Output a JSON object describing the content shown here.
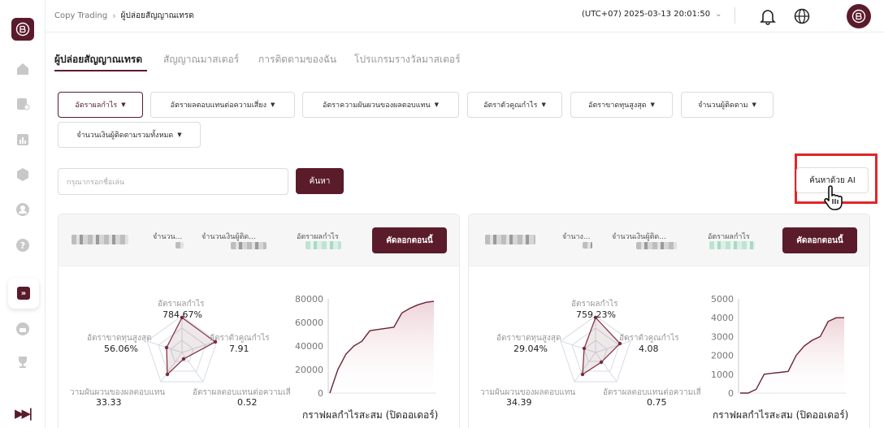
{
  "breadcrumb": {
    "root": "Copy Trading",
    "current": "ผู้ปล่อยสัญญาณเทรด"
  },
  "header": {
    "timezone": "(UTC+07)  2025-03-13 20:01:50"
  },
  "tabs": [
    {
      "label": "ผู้ปล่อยสัญญาณเทรด"
    },
    {
      "label": "สัญญาณมาสเตอร์"
    },
    {
      "label": "การติดตามของฉัน"
    },
    {
      "label": "โปรแกรมรางวัลมาสเตอร์"
    }
  ],
  "filters": [
    {
      "label": "อัตราผลกำไร"
    },
    {
      "label": "อัตราผลตอบแทนต่อความเสี่ยง"
    },
    {
      "label": "อัตราความผันผวนของผลตอบแทน"
    },
    {
      "label": "อัตราตัวคูณกำไร"
    },
    {
      "label": "อัตราขาดทุนสูงสุด"
    },
    {
      "label": "จำนวนผู้ติดตาม"
    },
    {
      "label": "จำนวนเงินผู้ติดตามรวมทั้งหมด"
    }
  ],
  "search": {
    "placeholder": "กรุณากรอกชื่อเล่น",
    "button": "ค้นหา",
    "ai_button": "ค้นหาด้วย AI"
  },
  "cards": [
    {
      "meta": {
        "followers": "จำนวน...",
        "amount": "จำนวนเงินผู้ติด...",
        "profit": "อัตราผลกำไร"
      },
      "copy_button": "คัดลอกตอนนี้",
      "radar": {
        "axes": [
          "อัตราผลกำไร",
          "อัตราตัวคูณกำไร",
          "อัตราผลตอบแทนต่อความเสี่ยง",
          "วามผันผวนของผลตอบแทน",
          "อัตราขาดทุนสูงสุด"
        ],
        "values": [
          "784.67%",
          "7.91",
          "0.52",
          "33.33",
          "56.06%"
        ]
      },
      "chart_caption": "กราฟผลกำไรสะสม (ปิดออเดอร์)",
      "chart_data": {
        "type": "area",
        "ylim": [
          0,
          80000
        ],
        "yticks": [
          "80000",
          "60000",
          "40000",
          "20000",
          "0"
        ],
        "y": [
          0,
          20000,
          33000,
          40000,
          44000,
          53000,
          54000,
          55000,
          56000,
          68000,
          72000,
          75000,
          77000,
          78000
        ]
      }
    },
    {
      "meta": {
        "followers": "จำนาง...",
        "amount": "จำนวนเงินผู้ติด...",
        "profit": "อัตราผลกำไร"
      },
      "copy_button": "คัดลอกตอนนี้",
      "radar": {
        "axes": [
          "อัตราผลกำไร",
          "อัตราตัวคูณกำไร",
          "อัตราผลตอบแทนต่อความเสี่ยง",
          "วามผันผวนของผลตอบแทน",
          "อัตราขาดทุนสูงสุด"
        ],
        "values": [
          "759.23%",
          "4.08",
          "0.75",
          "34.39",
          "29.04%"
        ]
      },
      "chart_caption": "กราฟผลกำไรสะสม (ปิดออเดอร์)",
      "chart_data": {
        "type": "area",
        "ylim": [
          0,
          5000
        ],
        "yticks": [
          "5000",
          "4000",
          "3000",
          "2000",
          "1000",
          "0"
        ],
        "y": [
          0,
          0,
          200,
          1000,
          1050,
          1100,
          1150,
          2000,
          2500,
          2800,
          3000,
          3800,
          4000,
          4000
        ]
      }
    }
  ],
  "colors": {
    "brand": "#5a1b2b",
    "highlight": "#e0262b"
  }
}
